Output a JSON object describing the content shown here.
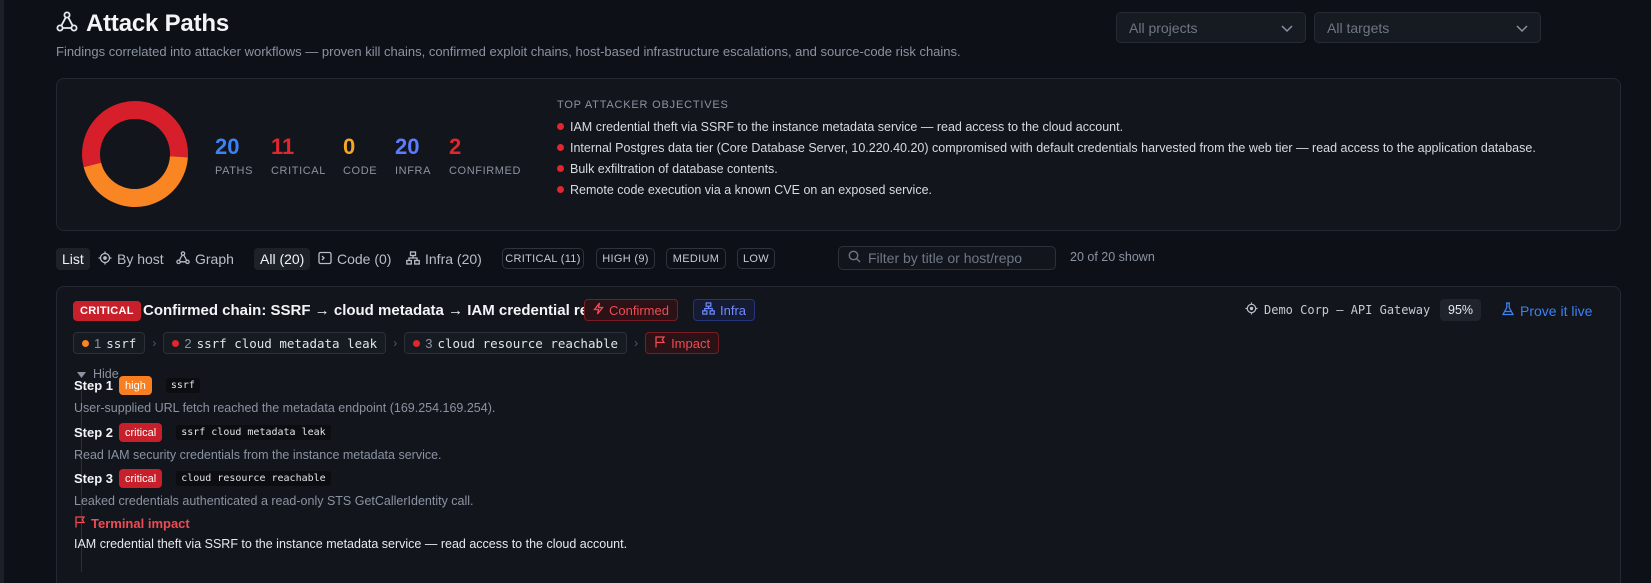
{
  "page": {
    "title": "Attack Paths",
    "subtitle": "Findings correlated into attacker workflows — proven kill chains, confirmed exploit chains, host-based infrastructure escalations, and source-code risk chains."
  },
  "filters": {
    "projects": "All projects",
    "targets": "All targets"
  },
  "summary": {
    "donut": {
      "segments": [
        {
          "label": "critical",
          "value": 11,
          "color": "#d61f2b"
        },
        {
          "label": "high",
          "value": 9,
          "color": "#f98523"
        }
      ]
    },
    "stats": [
      {
        "value": "20",
        "label": "PATHS",
        "color": "#3b82f6"
      },
      {
        "value": "11",
        "label": "CRITICAL",
        "color": "#e0262f"
      },
      {
        "value": "0",
        "label": "CODE",
        "color": "#f5a623"
      },
      {
        "value": "20",
        "label": "INFRA",
        "color": "#5b7cff"
      },
      {
        "value": "2",
        "label": "CONFIRMED",
        "color": "#e0262f"
      }
    ],
    "objectives_title": "TOP ATTACKER OBJECTIVES",
    "objectives": [
      "IAM credential theft via SSRF to the instance metadata service — read access to the cloud account.",
      "Internal Postgres data tier (Core Database Server, 10.220.40.20) compromised with default credentials harvested from the web tier — read access to the application database.",
      "Bulk exfiltration of database contents.",
      "Remote code execution via a known CVE on an exposed service."
    ]
  },
  "toolbar": {
    "views": [
      "List",
      "By host",
      "Graph"
    ],
    "scopes": [
      "All (20)",
      "Code (0)",
      "Infra (20)"
    ],
    "severities": [
      "CRITICAL (11)",
      "HIGH (9)",
      "MEDIUM",
      "LOW"
    ],
    "search_placeholder": "Filter by title or host/repo",
    "shown": "20 of 20 shown"
  },
  "card": {
    "severity": "CRITICAL",
    "title": "Confirmed chain: SSRF → cloud metadata → IAM credential read",
    "confirmed": "Confirmed",
    "category": "Infra",
    "target": "Demo Corp — API Gateway",
    "confidence": "95%",
    "prove": "Prove it live",
    "chain": [
      {
        "n": "1",
        "name": "ssrf",
        "color": "#f98523"
      },
      {
        "n": "2",
        "name": "ssrf cloud metadata leak",
        "color": "#e0262f"
      },
      {
        "n": "3",
        "name": "cloud resource reachable",
        "color": "#e0262f"
      }
    ],
    "impact_label": "Impact",
    "toggle": "Hide",
    "steps": [
      {
        "label": "Step 1",
        "severity": "high",
        "code": "ssrf",
        "desc": "User-supplied URL fetch reached the metadata endpoint (169.254.169.254)."
      },
      {
        "label": "Step 2",
        "severity": "critical",
        "code": "ssrf cloud metadata leak",
        "desc": "Read IAM security credentials from the instance metadata service."
      },
      {
        "label": "Step 3",
        "severity": "critical",
        "code": "cloud resource reachable",
        "desc": "Leaked credentials authenticated a read-only STS GetCallerIdentity call."
      }
    ],
    "terminal_title": "Terminal impact",
    "terminal_desc": "IAM credential theft via SSRF to the instance metadata service — read access to the cloud account."
  }
}
